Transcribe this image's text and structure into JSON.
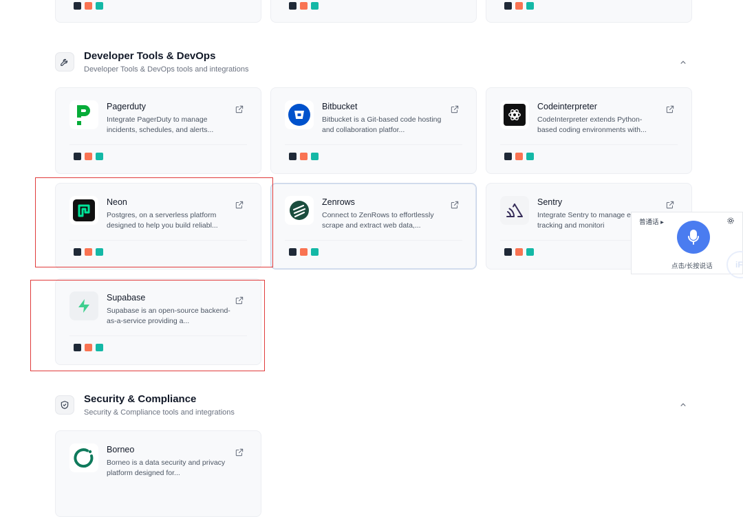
{
  "sections": {
    "devtools": {
      "title": "Developer Tools & DevOps",
      "subtitle": "Developer Tools & DevOps tools and integrations"
    },
    "security": {
      "title": "Security & Compliance",
      "subtitle": "Security & Compliance tools and integrations"
    }
  },
  "cards": {
    "pagerduty": {
      "title": "Pagerduty",
      "desc": "Integrate PagerDuty to manage incidents, schedules, and alerts..."
    },
    "bitbucket": {
      "title": "Bitbucket",
      "desc": "Bitbucket is a Git-based code hosting and collaboration platfor..."
    },
    "codeinterpreter": {
      "title": "Codeinterpreter",
      "desc": "CodeInterpreter extends Python-based coding environments with..."
    },
    "neon": {
      "title": "Neon",
      "desc": "Postgres, on a serverless platform designed to help you build reliabl..."
    },
    "zenrows": {
      "title": "Zenrows",
      "desc": "Connect to ZenRows to effortlessly scrape and extract web data,..."
    },
    "sentry": {
      "title": "Sentry",
      "desc": "Integrate Sentry to manage error tracking and monitori"
    },
    "supabase": {
      "title": "Supabase",
      "desc": "Supabase is an open-source backend-as-a-service providing a..."
    },
    "borneo": {
      "title": "Borneo",
      "desc": "Borneo is a data security and privacy platform designed for..."
    }
  },
  "voice_widget": {
    "language": "普通话 ▸",
    "hint": "点击/长按说话",
    "brand": "iFl"
  },
  "colors": {
    "pagerduty": "#06ac38",
    "bitbucket": "#2684ff",
    "neon": "#00e599",
    "zenrows": "#1b4d3e",
    "supabase": "#3ecf8e",
    "borneo": "#0f7a5c",
    "highlight": "#e03a3a",
    "mic": "#4a7cf0"
  }
}
